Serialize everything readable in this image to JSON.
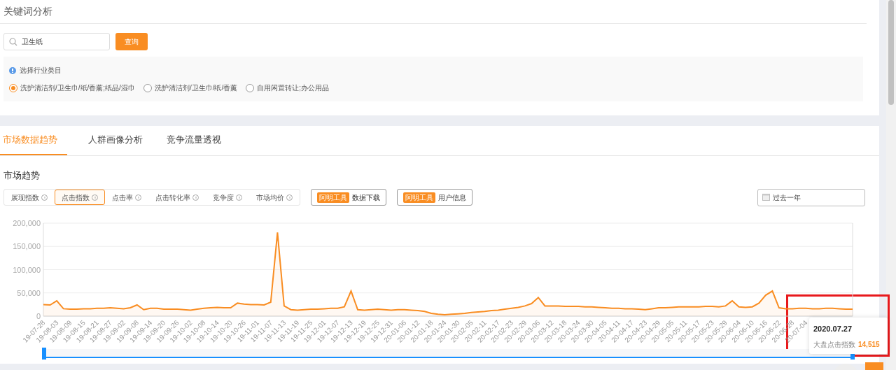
{
  "page_title": "关键词分析",
  "search": {
    "value": "卫生纸",
    "button": "查询"
  },
  "category": {
    "label": "选择行业类目",
    "options": [
      {
        "label": "洗护清洁剂/卫生巾/纸/香薰;纸品/湿巾",
        "selected": true
      },
      {
        "label": "洗护清洁剂/卫生巾/纸/香薰",
        "selected": false
      },
      {
        "label": "自用闲置转让;办公用品",
        "selected": false
      }
    ]
  },
  "tabs": [
    {
      "label": "市场数据趋势",
      "selected": true
    },
    {
      "label": "人群画像分析",
      "selected": false
    },
    {
      "label": "竞争流量透视",
      "selected": false
    }
  ],
  "section_title": "市场趋势",
  "metrics": [
    {
      "label": "展现指数",
      "selected": false
    },
    {
      "label": "点击指数",
      "selected": true
    },
    {
      "label": "点击率",
      "selected": false
    },
    {
      "label": "点击转化率",
      "selected": false
    },
    {
      "label": "竞争度",
      "selected": false
    },
    {
      "label": "市场均价",
      "selected": false
    }
  ],
  "tool_buttons": [
    {
      "badge": "阿明工具",
      "label": "数据下载"
    },
    {
      "badge": "阿明工具",
      "label": "用户信息"
    }
  ],
  "date_range": {
    "value": "过去一年"
  },
  "chart": {
    "chart_data": {
      "type": "area",
      "grid": true,
      "categories": [
        "19-07-28",
        null,
        "19-08-03",
        null,
        "19-08-09",
        null,
        "19-08-15",
        null,
        "19-08-21",
        null,
        "19-08-27",
        null,
        "19-09-02",
        null,
        "19-09-08",
        null,
        "19-09-14",
        null,
        "19-09-20",
        null,
        "19-09-26",
        null,
        "19-10-02",
        null,
        "19-10-08",
        null,
        "19-10-14",
        null,
        "19-10-20",
        null,
        "19-10-26",
        null,
        "19-11-01",
        null,
        "19-11-07",
        null,
        "19-11-13",
        null,
        "19-11-19",
        null,
        "19-11-25",
        null,
        "19-12-01",
        null,
        "19-12-07",
        null,
        "19-12-13",
        null,
        "19-12-19",
        null,
        "19-12-25",
        null,
        "19-12-31",
        null,
        "20-01-06",
        null,
        "20-01-12",
        null,
        "20-01-18",
        null,
        "20-01-24",
        null,
        "20-01-30",
        null,
        "20-02-05",
        null,
        "20-02-11",
        null,
        "20-02-17",
        null,
        "20-02-23",
        null,
        "20-02-29",
        null,
        "20-03-06",
        null,
        "20-03-12",
        null,
        "20-03-18",
        null,
        "20-03-24",
        null,
        "20-03-30",
        null,
        "20-04-05",
        null,
        "20-04-11",
        null,
        "20-04-17",
        null,
        "20-04-23",
        null,
        "20-04-29",
        null,
        "20-05-05",
        null,
        "20-05-11",
        null,
        "20-05-17",
        null,
        "20-05-23",
        null,
        "20-05-29",
        null,
        "20-06-04",
        null,
        "20-06-10",
        null,
        "20-06-16",
        null,
        "20-06-22",
        null,
        "20-06-28",
        null,
        "20-07-04",
        null,
        null,
        null,
        null,
        null,
        null,
        null
      ],
      "series": [
        {
          "color": "#f98d22",
          "values": [
            25000,
            24000,
            33000,
            16000,
            15000,
            15000,
            16000,
            16000,
            17000,
            17000,
            18000,
            17000,
            16000,
            18000,
            24000,
            14000,
            17000,
            17000,
            15000,
            15000,
            15000,
            14000,
            13000,
            15000,
            17000,
            18000,
            19000,
            18000,
            18000,
            28000,
            26000,
            25000,
            25000,
            24000,
            30000,
            180000,
            22000,
            14000,
            13000,
            14000,
            15000,
            15000,
            16000,
            17000,
            17000,
            20000,
            54000,
            14000,
            13000,
            14000,
            15000,
            14000,
            13000,
            14000,
            14000,
            13000,
            12000,
            10000,
            6000,
            4000,
            3000,
            4000,
            5000,
            6000,
            8000,
            9000,
            10000,
            12000,
            13000,
            15000,
            17000,
            19000,
            22000,
            27000,
            40000,
            22000,
            22000,
            22000,
            21000,
            21000,
            21000,
            20000,
            20000,
            19000,
            18000,
            17000,
            17000,
            16000,
            16000,
            15000,
            14000,
            16000,
            18000,
            18000,
            19000,
            20000,
            20000,
            20000,
            20000,
            21000,
            21000,
            20000,
            22000,
            33000,
            20000,
            19000,
            20000,
            28000,
            45000,
            54000,
            18000,
            16000,
            16000,
            17000,
            17000,
            16000,
            16000,
            17000,
            17000,
            16000,
            15000,
            15000
          ]
        }
      ],
      "ylim": [
        0,
        200000
      ],
      "yticks": [
        {
          "value": 0,
          "label": "0"
        },
        {
          "value": 50000,
          "label": "50,000"
        },
        {
          "value": 100000,
          "label": "100,000"
        },
        {
          "value": 150000,
          "label": "150,000"
        },
        {
          "value": 200000,
          "label": "200,000"
        }
      ]
    }
  },
  "tooltip": {
    "date": "2020.07.27",
    "label": "大盘点击指数",
    "value": "14,515"
  }
}
